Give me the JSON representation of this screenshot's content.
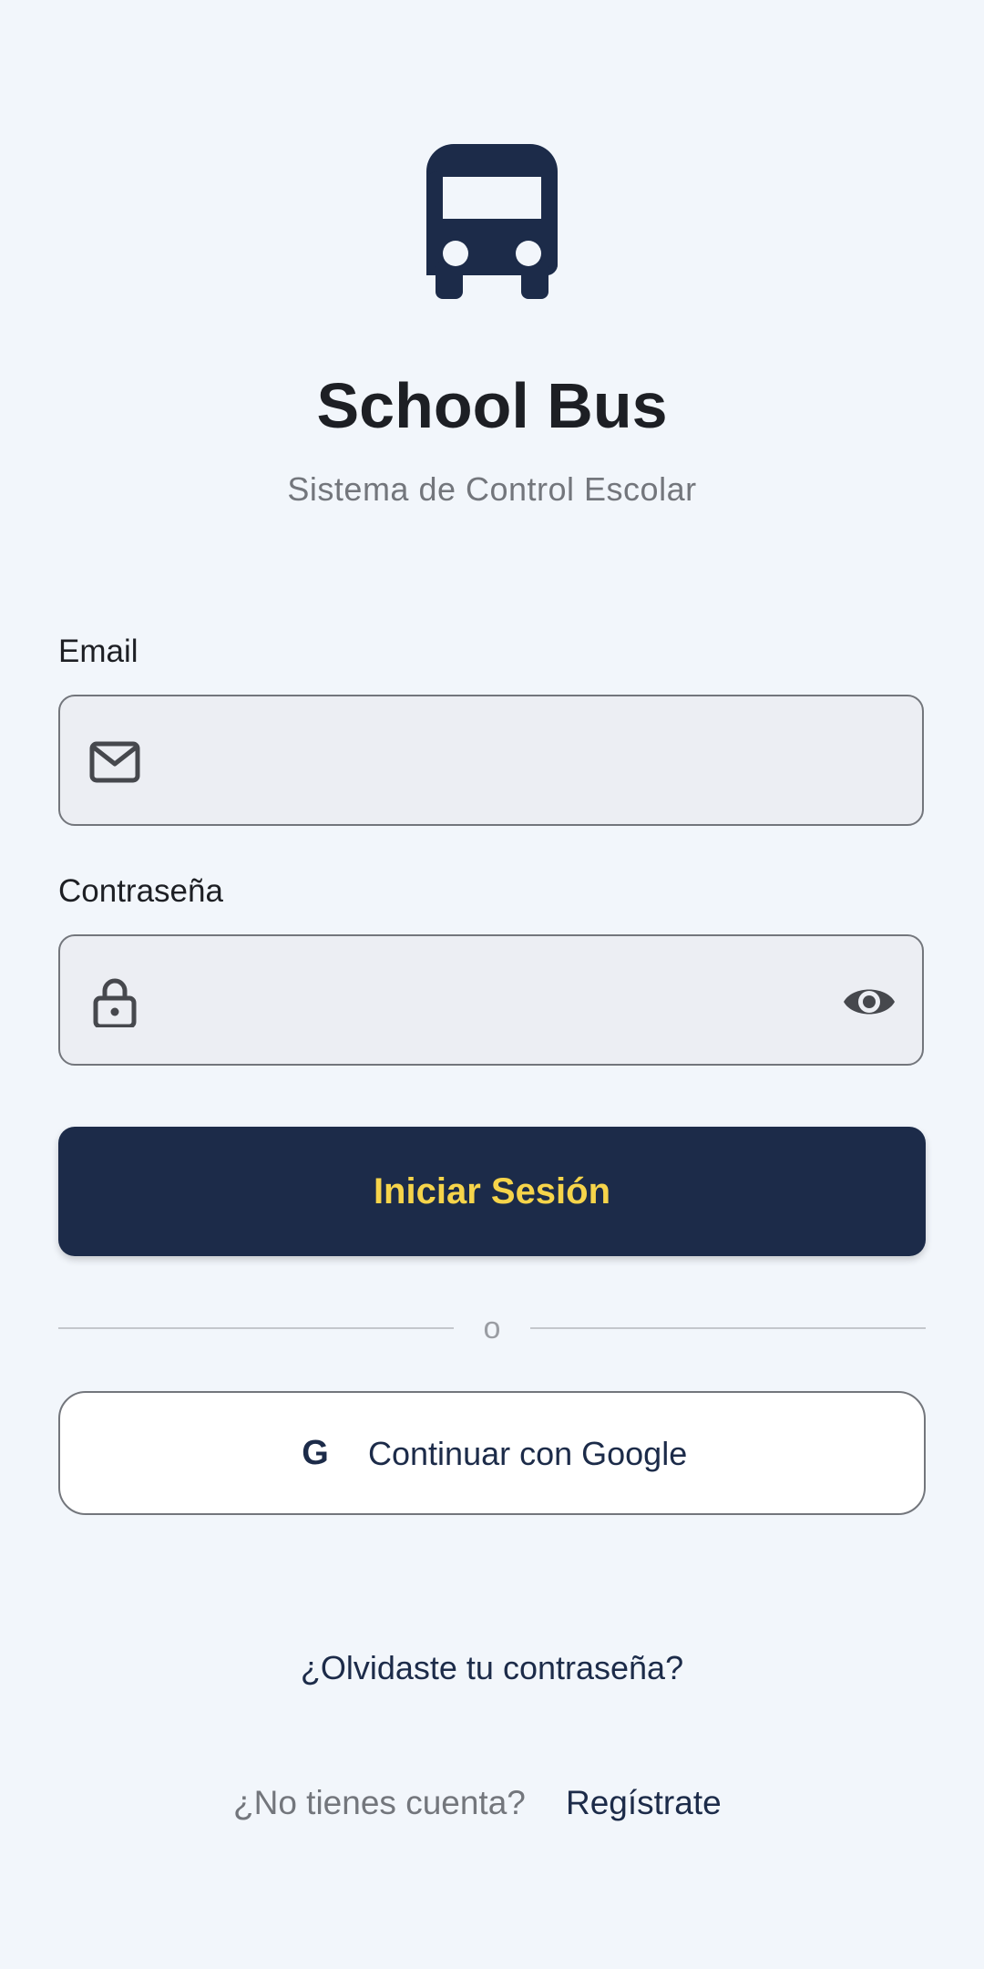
{
  "app": {
    "title": "School Bus",
    "subtitle": "Sistema de Control Escolar",
    "logo_icon": "bus-icon"
  },
  "form": {
    "email_label": "Email",
    "email_value": "",
    "email_icon": "mail-icon",
    "password_label": "Contraseña",
    "password_value": "",
    "password_icon": "lock-icon",
    "visibility_icon": "eye-icon",
    "login_button": "Iniciar Sesión",
    "divider_text": "o",
    "google_button": "Continuar con Google",
    "google_icon": "google-icon",
    "google_glyph": "G"
  },
  "links": {
    "forgot_password": "¿Olvidaste tu contraseña?",
    "no_account": "¿No tienes cuenta?",
    "register": "Regístrate"
  },
  "colors": {
    "background": "#f2f6fb",
    "primary": "#1c2b49",
    "accent": "#f6d44a",
    "input_fill": "#eceef3",
    "border": "#73767c"
  }
}
